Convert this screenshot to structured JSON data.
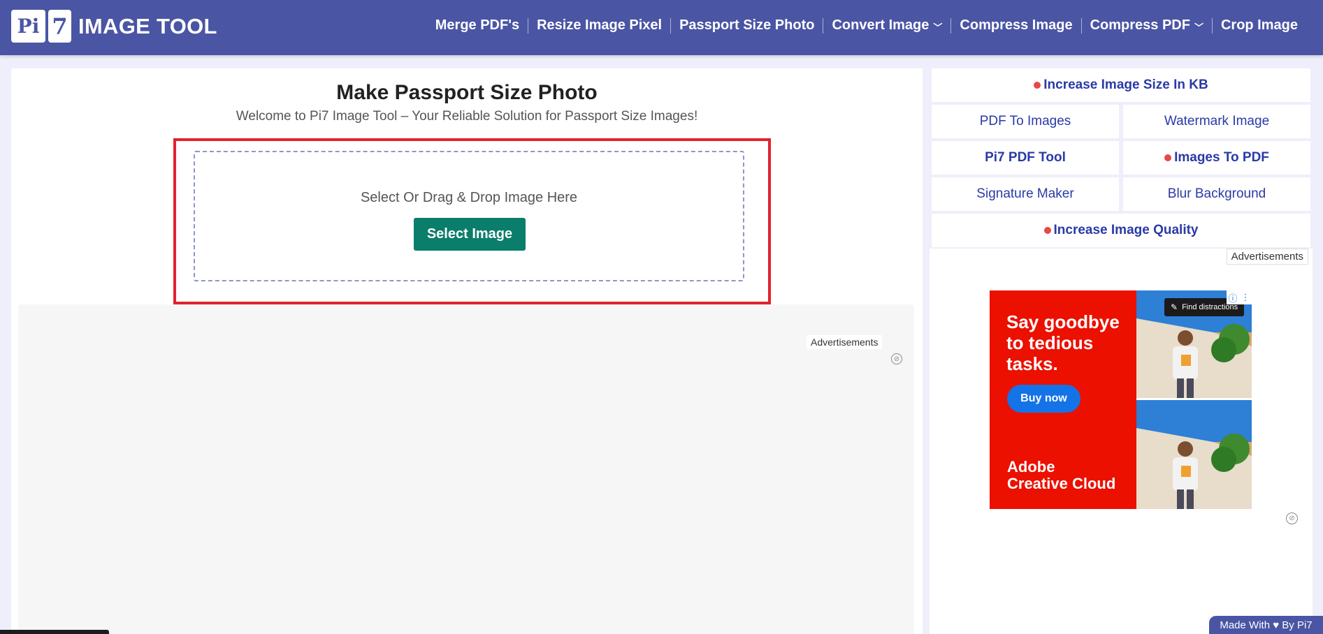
{
  "logo": {
    "box1": "Pi",
    "box2": "7",
    "text": "IMAGE TOOL"
  },
  "nav": [
    {
      "label": "Merge PDF's",
      "dropdown": false
    },
    {
      "label": "Resize Image Pixel",
      "dropdown": false
    },
    {
      "label": "Passport Size Photo",
      "dropdown": false
    },
    {
      "label": "Convert Image",
      "dropdown": true
    },
    {
      "label": "Compress Image",
      "dropdown": false
    },
    {
      "label": "Compress PDF",
      "dropdown": true
    },
    {
      "label": "Crop Image",
      "dropdown": false
    }
  ],
  "main": {
    "title": "Make Passport Size Photo",
    "subtitle": "Welcome to Pi7 Image Tool – Your Reliable Solution for Passport Size Images!",
    "drop_text": "Select Or Drag & Drop Image Here",
    "select_button": "Select Image",
    "ad_label": "Advertisements"
  },
  "sidebar": {
    "links": [
      {
        "label": "Increase Image Size In KB",
        "bold": true,
        "dot": true
      },
      {
        "label": "PDF To Images",
        "bold": false,
        "dot": false
      },
      {
        "label": "Watermark Image",
        "bold": false,
        "dot": false
      },
      {
        "label": "Pi7 PDF Tool",
        "bold": true,
        "dot": false
      },
      {
        "label": "Images To PDF",
        "bold": true,
        "dot": true
      },
      {
        "label": "Signature Maker",
        "bold": false,
        "dot": false
      },
      {
        "label": "Blur Background",
        "bold": false,
        "dot": false
      },
      {
        "label": "Increase Image Quality",
        "bold": true,
        "dot": true
      }
    ],
    "ad_label": "Advertisements",
    "banner": {
      "headline": "Say goodbye to tedious tasks.",
      "cta": "Buy now",
      "brand_line1": "Adobe",
      "brand_line2": "Creative Cloud",
      "find_pill": "Find distractions"
    }
  },
  "footer": {
    "made_with": "Made With ♥ By  Pi7"
  },
  "colors": {
    "header": "#4a55a4",
    "accent_button": "#0b7d6b",
    "highlight_frame": "#e0232e",
    "link": "#2a3aa6",
    "dot": "#e74848",
    "ad_red": "#eb1000",
    "ad_blue": "#1473e6"
  }
}
